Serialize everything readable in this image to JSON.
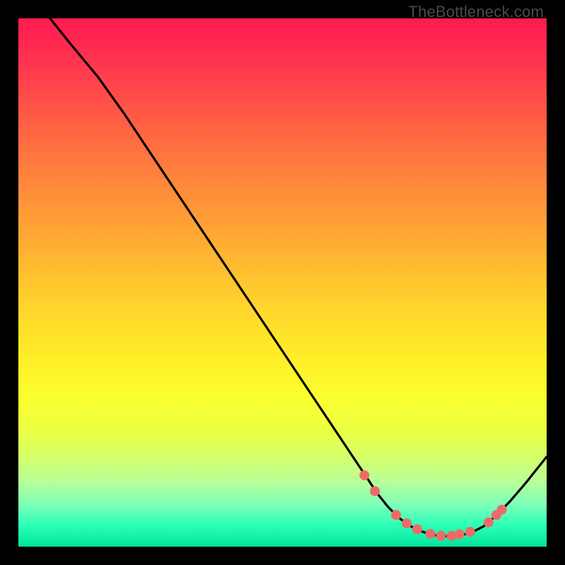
{
  "watermark": "TheBottleneck.com",
  "colors": {
    "background": "#000000",
    "curve": "#000000",
    "dot_fill": "#ef6a66",
    "dot_stroke": "#ef6a66"
  },
  "chart_data": {
    "type": "line",
    "title": "",
    "xlabel": "",
    "ylabel": "",
    "xlim": [
      0,
      100
    ],
    "ylim": [
      0,
      100
    ],
    "grid": false,
    "legend": false,
    "series": [
      {
        "name": "bottleneck-curve",
        "x": [
          6,
          10,
          15,
          20,
          25,
          30,
          35,
          40,
          45,
          50,
          55,
          60,
          65,
          68,
          70,
          72,
          74,
          76,
          78,
          80,
          82,
          84,
          86,
          88,
          90,
          93,
          96,
          100
        ],
        "y": [
          100,
          95,
          89,
          82,
          74.5,
          67,
          59.5,
          52,
          44.5,
          37,
          29.5,
          22,
          14.5,
          10,
          7.5,
          5.5,
          4,
          3,
          2.3,
          2,
          2,
          2.2,
          2.8,
          3.8,
          5.5,
          8.5,
          12,
          17
        ]
      }
    ],
    "points": [
      {
        "x": 65.5,
        "y": 13.5
      },
      {
        "x": 67.5,
        "y": 10.5
      },
      {
        "x": 71.5,
        "y": 6.0
      },
      {
        "x": 73.5,
        "y": 4.4
      },
      {
        "x": 75.5,
        "y": 3.3
      },
      {
        "x": 78.0,
        "y": 2.4
      },
      {
        "x": 80.0,
        "y": 2.05
      },
      {
        "x": 82.0,
        "y": 2.05
      },
      {
        "x": 83.5,
        "y": 2.35
      },
      {
        "x": 85.5,
        "y": 2.8
      },
      {
        "x": 89.0,
        "y": 4.6
      },
      {
        "x": 90.5,
        "y": 6.0
      },
      {
        "x": 91.5,
        "y": 7.0
      }
    ],
    "dot_radius": 7
  }
}
